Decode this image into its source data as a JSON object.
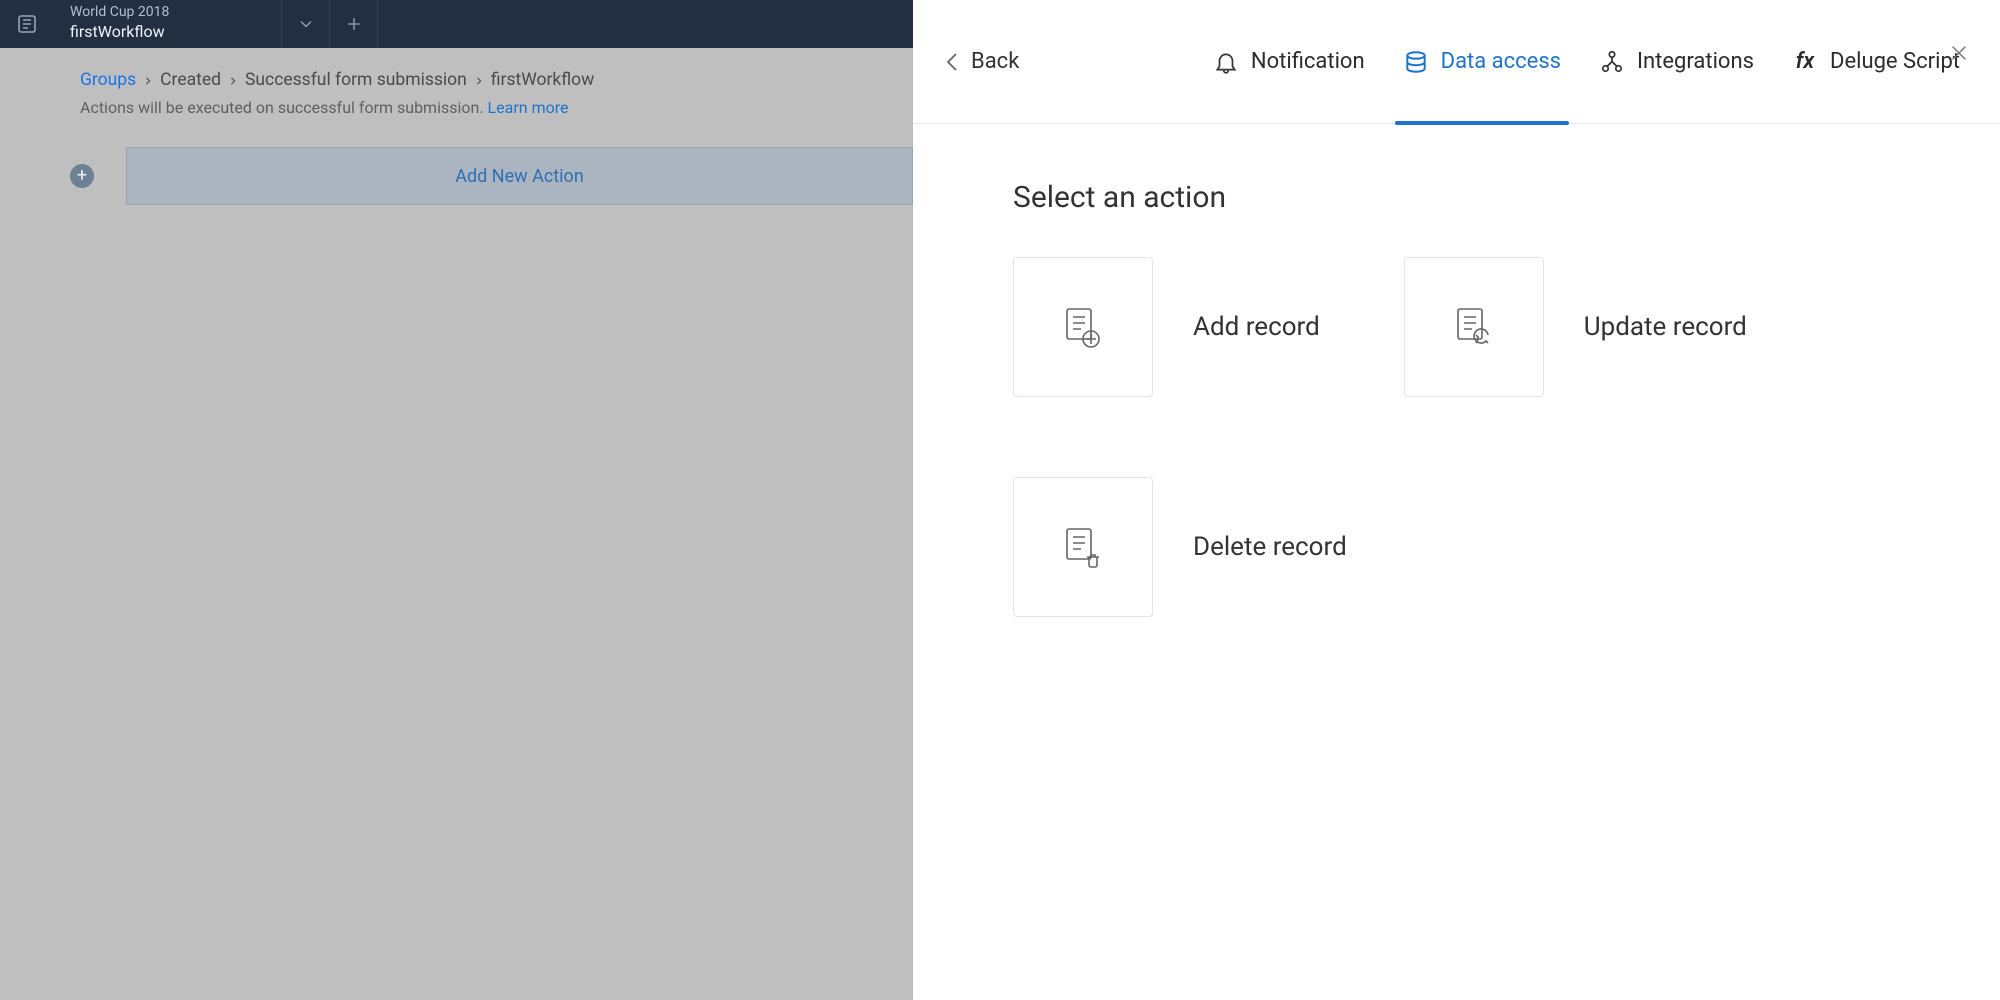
{
  "topbar": {
    "app_name": "World Cup 2018",
    "workflow_name": "firstWorkflow"
  },
  "breadcrumb": {
    "items": [
      "Groups",
      "Created",
      "Successful form submission",
      "firstWorkflow"
    ]
  },
  "subtext": {
    "text": "Actions will be executed on successful form submission.",
    "link": "Learn more"
  },
  "action_row": {
    "label": "Add New Action"
  },
  "drawer": {
    "back": "Back",
    "tabs": {
      "notification": "Notification",
      "data_access": "Data access",
      "integrations": "Integrations",
      "deluge": "Deluge Script"
    },
    "heading": "Select an action",
    "actions": {
      "add": "Add record",
      "update": "Update record",
      "delete": "Delete record"
    }
  }
}
